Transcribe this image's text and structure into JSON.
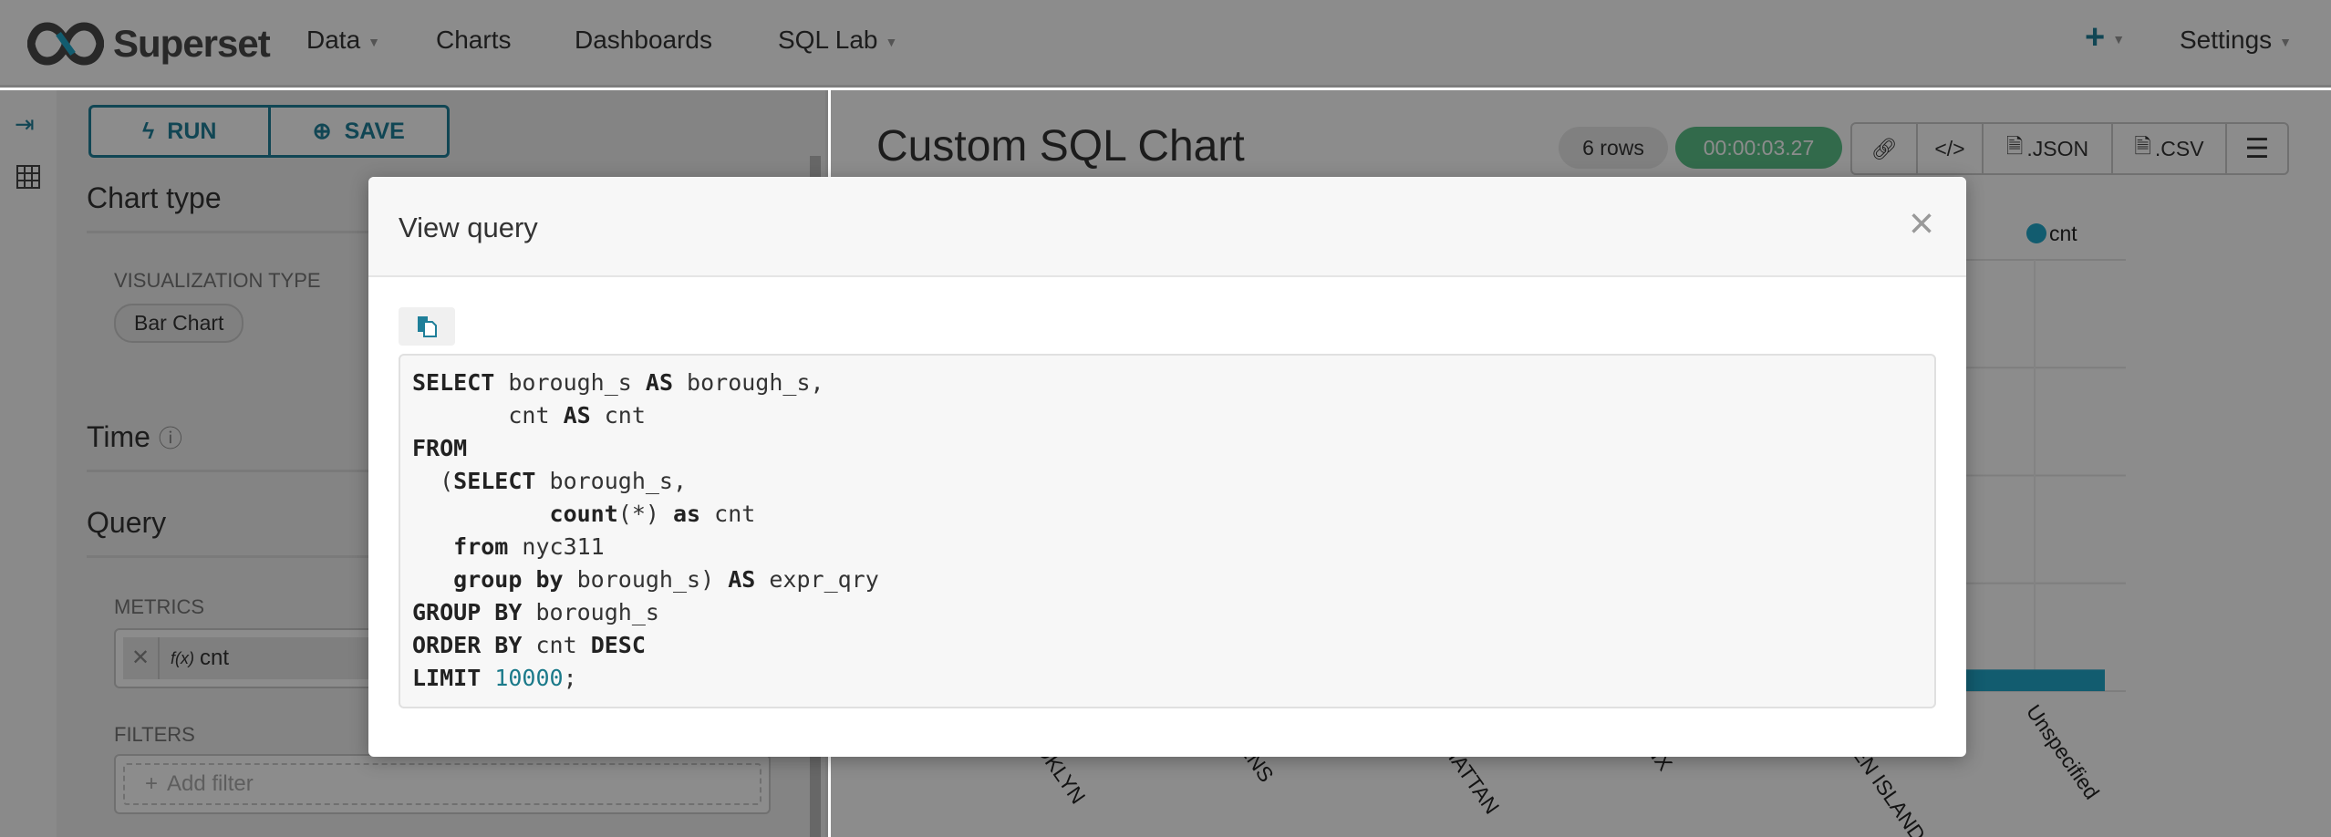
{
  "navbar": {
    "brand": "Superset",
    "items": [
      {
        "label": "Data",
        "has_caret": true
      },
      {
        "label": "Charts",
        "has_caret": false
      },
      {
        "label": "Dashboards",
        "has_caret": false
      },
      {
        "label": "SQL Lab",
        "has_caret": true
      }
    ],
    "add_icon": "plus-icon",
    "settings_label": "Settings"
  },
  "sidebar_icons": [
    "collapse-icon",
    "grid-icon"
  ],
  "control_panel": {
    "run_label": "RUN",
    "save_label": "SAVE",
    "chart_type_heading": "Chart type",
    "visualization_type_label": "VISUALIZATION TYPE",
    "visualization_type_value": "Bar Chart",
    "time_heading": "Time",
    "query_heading": "Query",
    "metrics_label": "METRICS",
    "metric_value": "cnt",
    "metric_fx": "f(x)",
    "filters_label": "FILTERS",
    "add_filter_label": "Add filter"
  },
  "chart_header": {
    "title": "Custom SQL Chart",
    "rows_badge": "6 rows",
    "timer": "00:00:03.27",
    "json_label": ".JSON",
    "csv_label": ".CSV"
  },
  "colors": {
    "brand": "#1f7f99",
    "bar": "#20a7c9",
    "timer": "#5ac189"
  },
  "chart_data": {
    "type": "bar",
    "legend": [
      "cnt"
    ],
    "legend_placement": "top-right",
    "categories": [
      "BROOKLYN",
      "QUEENS",
      "MANHATTAN",
      "BRONX",
      "STATEN ISLAND",
      "Unspecified"
    ],
    "series": [
      {
        "name": "cnt",
        "values": [
          null,
          null,
          null,
          null,
          null,
          0.05
        ]
      }
    ],
    "note_values": "only the Unspecified bar is visible; its height is about 5% of the plot height",
    "grid": true
  },
  "modal": {
    "title": "View query",
    "code_lines": [
      [
        [
          "SELECT",
          "kw"
        ],
        [
          " borough_s ",
          ""
        ],
        [
          "AS",
          "kw"
        ],
        [
          " borough_s,",
          ""
        ]
      ],
      [
        [
          "       cnt ",
          ""
        ],
        [
          "AS",
          "kw"
        ],
        [
          " cnt",
          ""
        ]
      ],
      [
        [
          "FROM",
          "kw"
        ]
      ],
      [
        [
          "  (",
          ""
        ],
        [
          "SELECT",
          "kw"
        ],
        [
          " borough_s,",
          ""
        ]
      ],
      [
        [
          "          ",
          ""
        ],
        [
          "count",
          "kw"
        ],
        [
          "(*) ",
          ""
        ],
        [
          "as",
          "kw"
        ],
        [
          " cnt",
          ""
        ]
      ],
      [
        [
          "   ",
          ""
        ],
        [
          "from",
          "kw"
        ],
        [
          " nyc311",
          ""
        ]
      ],
      [
        [
          "   ",
          ""
        ],
        [
          "group by",
          "kw"
        ],
        [
          " borough_s) ",
          ""
        ],
        [
          "AS",
          "kw"
        ],
        [
          " expr_qry",
          ""
        ]
      ],
      [
        [
          "GROUP BY",
          "kw"
        ],
        [
          " borough_s",
          ""
        ]
      ],
      [
        [
          "ORDER BY",
          "kw"
        ],
        [
          " cnt ",
          ""
        ],
        [
          "DESC",
          "kw"
        ]
      ],
      [
        [
          "LIMIT",
          "kw"
        ],
        [
          " ",
          ""
        ],
        [
          "10000",
          "num"
        ],
        [
          ";",
          ""
        ]
      ]
    ]
  }
}
